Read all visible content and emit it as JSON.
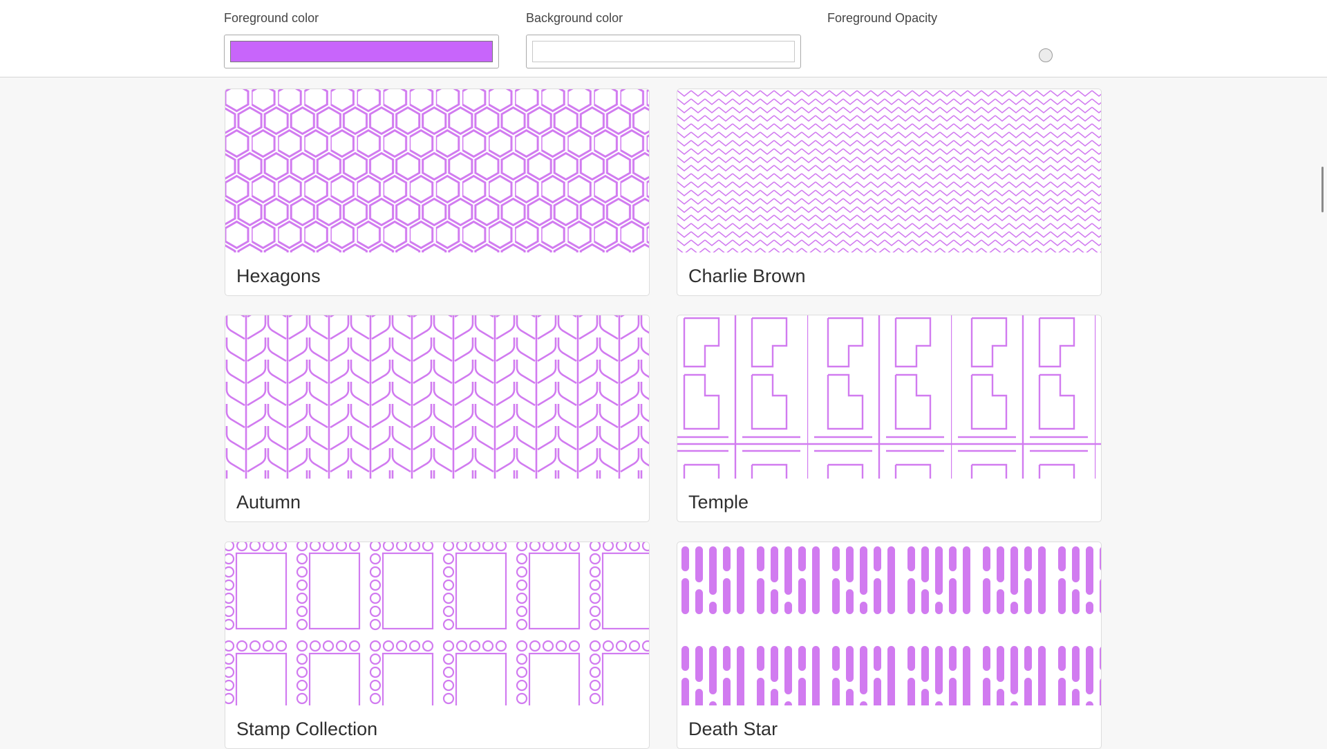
{
  "colors": {
    "foreground": "#cc66ff",
    "foreground_swatch": "#c865fb",
    "background": "#ffffff",
    "pattern_stroke": "#d17bf0"
  },
  "controls": {
    "foreground_label": "Foreground color",
    "background_label": "Background color",
    "opacity_label": "Foreground Opacity"
  },
  "patterns": [
    {
      "name": "Hexagons",
      "icon": "hexagons-pattern"
    },
    {
      "name": "Charlie Brown",
      "icon": "zigzag-pattern"
    },
    {
      "name": "Autumn",
      "icon": "chevron-leaf-pattern"
    },
    {
      "name": "Temple",
      "icon": "temple-lattice-pattern"
    },
    {
      "name": "Stamp Collection",
      "icon": "stamp-pattern"
    },
    {
      "name": "Death Star",
      "icon": "bars-pattern"
    }
  ]
}
